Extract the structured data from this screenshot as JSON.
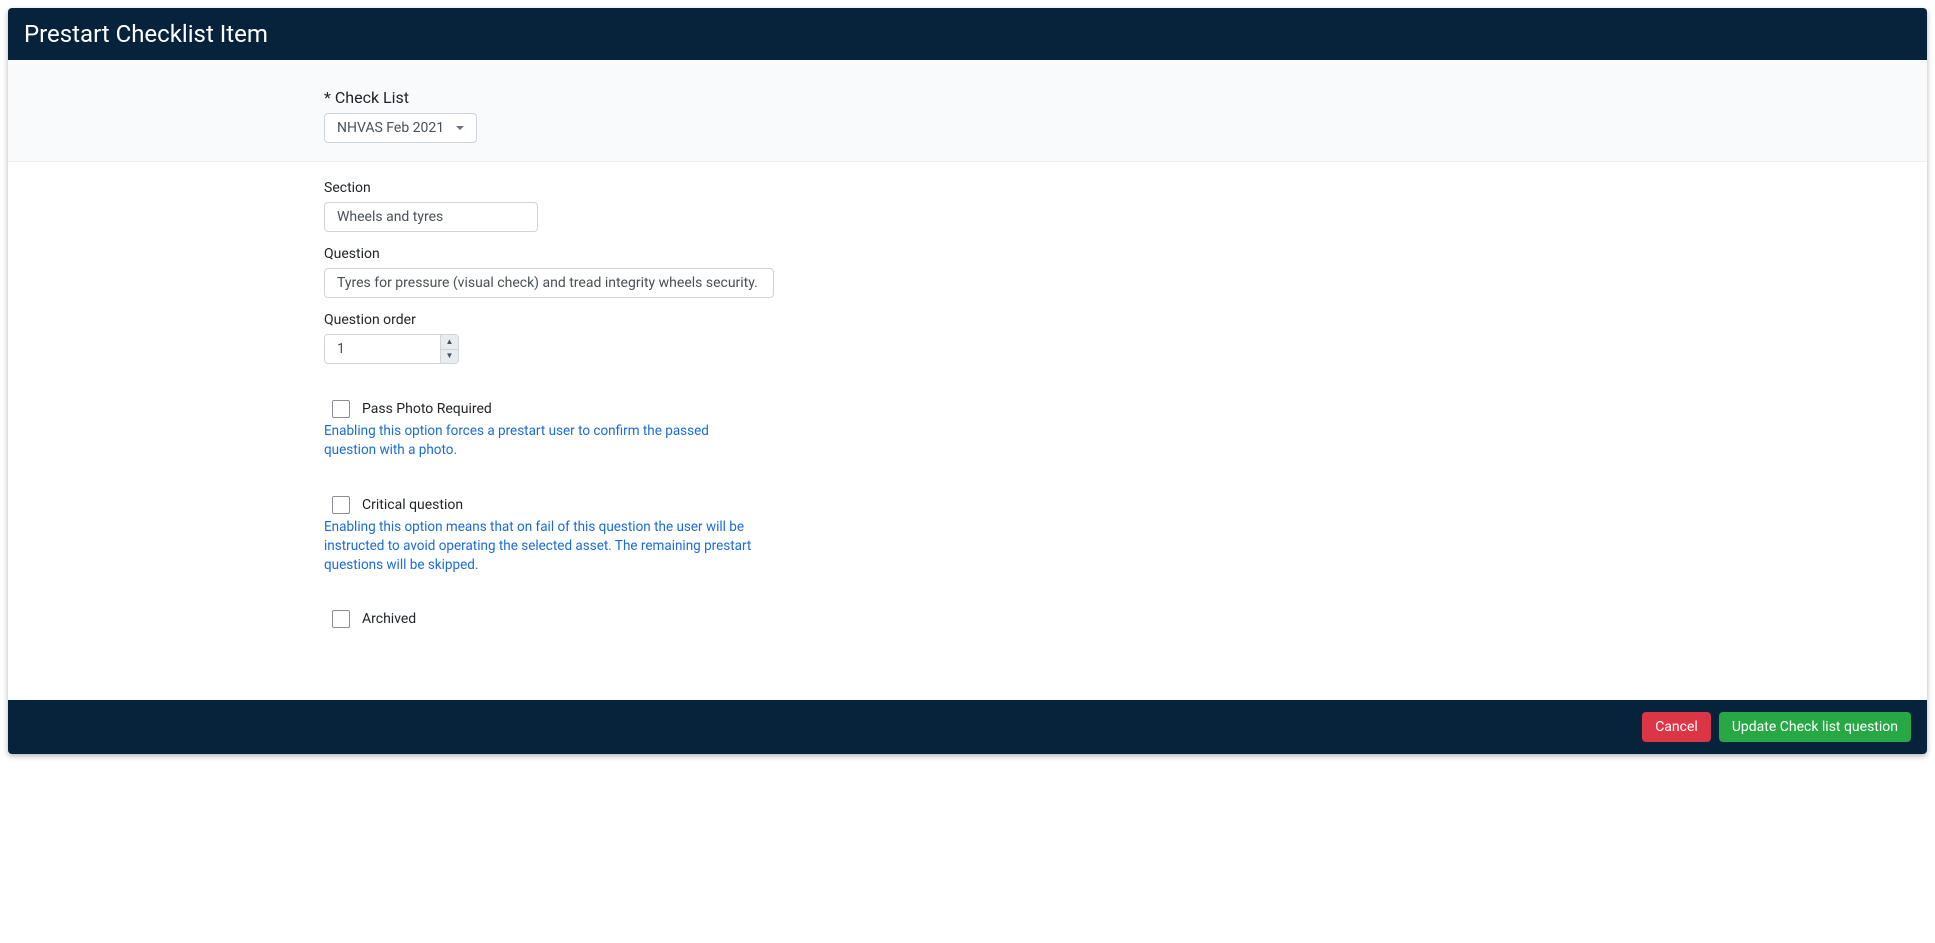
{
  "header": {
    "title": "Prestart Checklist Item"
  },
  "form": {
    "checklist": {
      "label": "* Check List",
      "selected": "NHVAS Feb 2021"
    },
    "section": {
      "label": "Section",
      "value": "Wheels and tyres"
    },
    "question": {
      "label": "Question",
      "value": "Tyres for pressure (visual check) and tread integrity wheels security."
    },
    "questionOrder": {
      "label": "Question order",
      "value": "1"
    },
    "passPhoto": {
      "label": "Pass Photo Required",
      "help": "Enabling this option forces a prestart user to confirm the passed question with a photo."
    },
    "critical": {
      "label": "Critical question",
      "help": "Enabling this option means that on fail of this question the user will be instructed to avoid operating the selected asset. The remaining prestart questions will be skipped."
    },
    "archived": {
      "label": "Archived"
    }
  },
  "footer": {
    "cancel": "Cancel",
    "update": "Update Check list question"
  }
}
